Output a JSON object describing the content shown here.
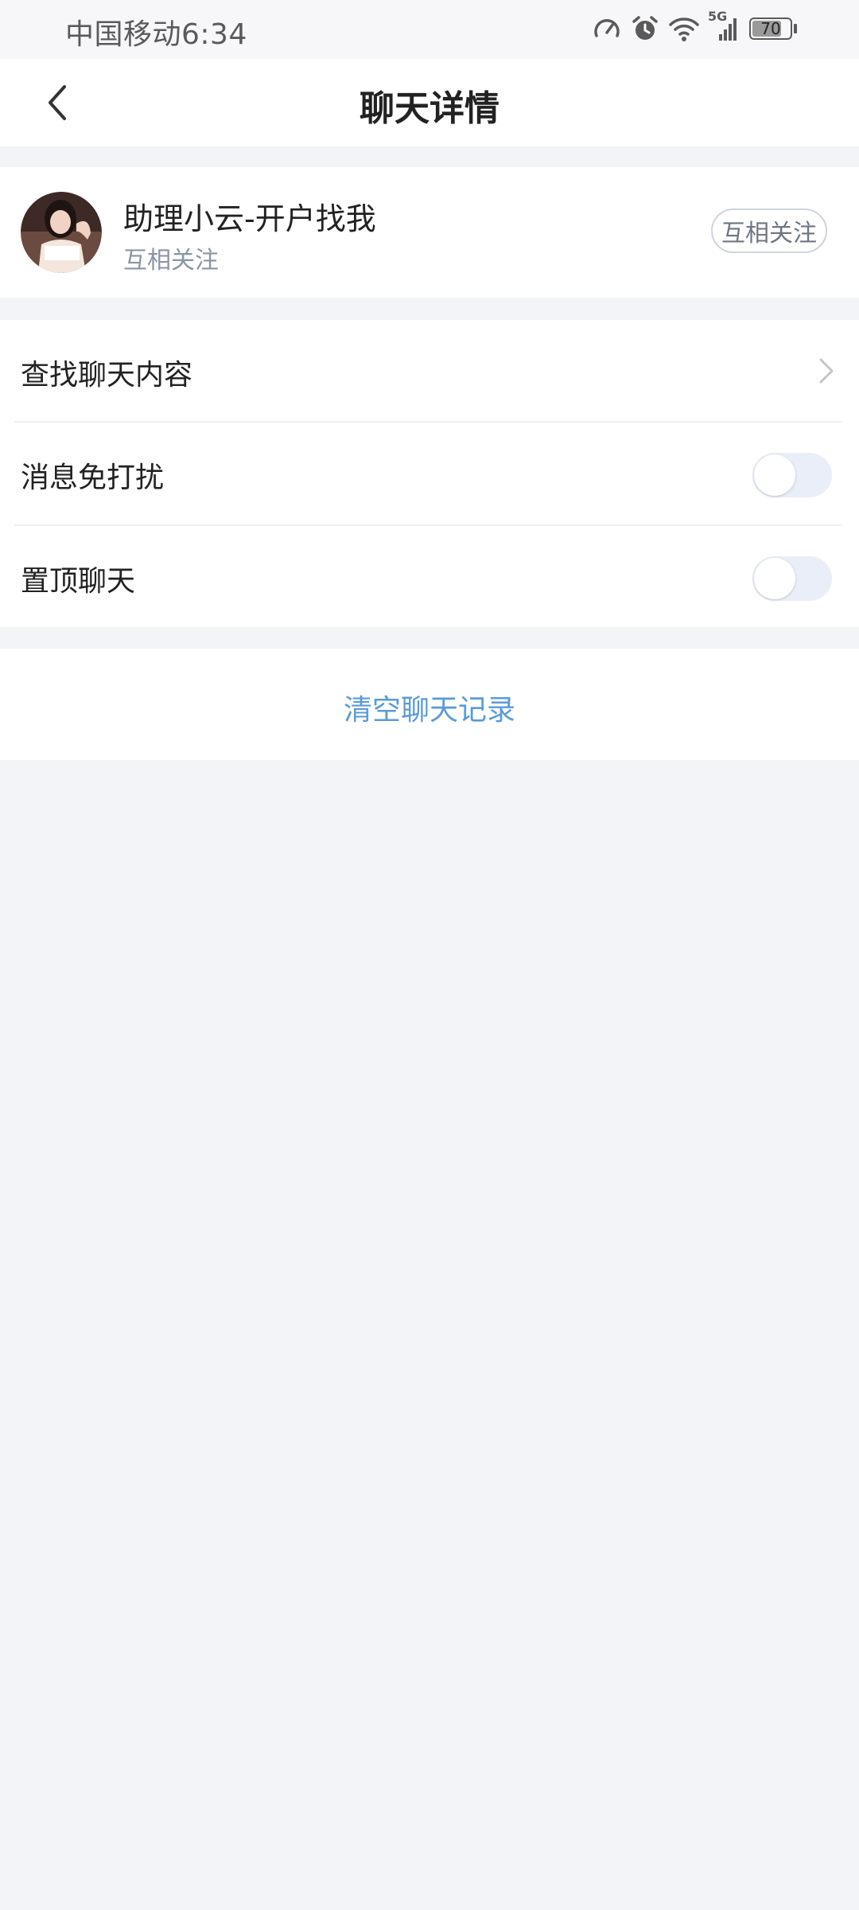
{
  "status_bar": {
    "carrier": "中国移动",
    "time": "6:34",
    "network": "5G",
    "battery": "70",
    "icons": [
      "speedometer-icon",
      "alarm-icon",
      "wifi-icon",
      "signal-icon",
      "battery-icon"
    ]
  },
  "header": {
    "title": "聊天详情",
    "back_icon": "chevron-left-icon"
  },
  "profile": {
    "name": "助理小云-开户找我",
    "relation": "互相关注",
    "follow_button": "互相关注"
  },
  "settings": {
    "items": [
      {
        "label": "查找聊天内容",
        "control": "chevron-right-icon"
      },
      {
        "label": "消息免打扰",
        "control": "toggle",
        "on": false
      },
      {
        "label": "置顶聊天",
        "control": "toggle",
        "on": false
      }
    ]
  },
  "actions": {
    "clear_history": "清空聊天记录"
  },
  "colors": {
    "page_background": "#f3f4f8",
    "card_background": "#ffffff",
    "link_blue": "#5a9bd8",
    "secondary_text": "#8a94a3",
    "toggle_off": "#e9eef8"
  }
}
